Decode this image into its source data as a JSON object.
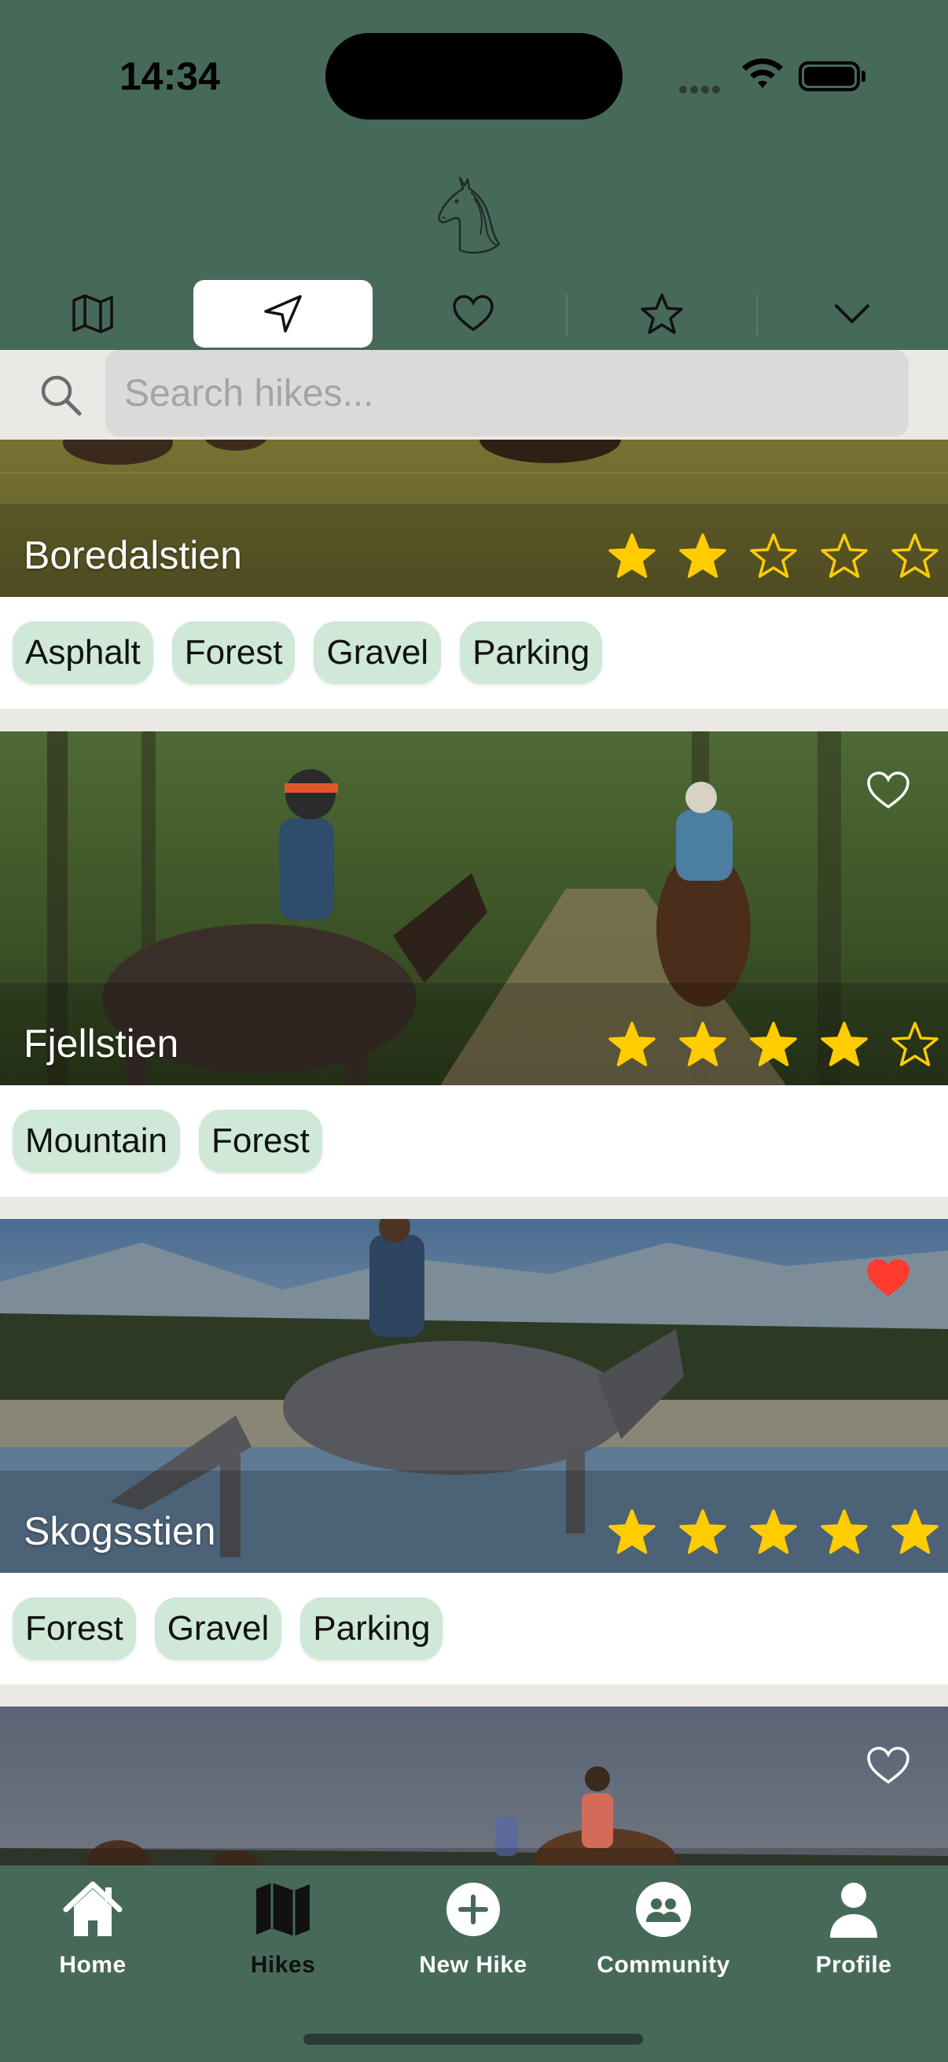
{
  "status_bar": {
    "time": "14:34"
  },
  "header": {
    "logo_icon": "horse-head-icon",
    "tabs": [
      {
        "icon": "map-icon",
        "active": false
      },
      {
        "icon": "navigation-arrow-icon",
        "active": true
      },
      {
        "icon": "heart-icon",
        "active": false
      },
      {
        "icon": "star-icon",
        "active": false
      },
      {
        "icon": "chevron-down-icon",
        "active": false
      }
    ]
  },
  "search": {
    "placeholder": "Search hikes...",
    "value": ""
  },
  "hikes": [
    {
      "name": "Boredalstien",
      "rating": 2,
      "favorite": false,
      "tags": [
        "Asphalt",
        "Forest",
        "Gravel",
        "Parking"
      ]
    },
    {
      "name": "Fjellstien",
      "rating": 4,
      "favorite": false,
      "tags": [
        "Mountain",
        "Forest"
      ]
    },
    {
      "name": "Skogsstien",
      "rating": 5,
      "favorite": true,
      "tags": [
        "Forest",
        "Gravel",
        "Parking"
      ]
    },
    {
      "name": "",
      "rating": 0,
      "favorite": false,
      "tags": []
    }
  ],
  "bottom_nav": [
    {
      "label": "Home",
      "icon": "home-icon",
      "active": false
    },
    {
      "label": "Hikes",
      "icon": "map-icon",
      "active": true
    },
    {
      "label": "New Hike",
      "icon": "plus-circle-icon",
      "active": false
    },
    {
      "label": "Community",
      "icon": "community-icon",
      "active": false
    },
    {
      "label": "Profile",
      "icon": "profile-icon",
      "active": false
    }
  ],
  "colors": {
    "primary": "#47695a",
    "tag_bg": "#cfe8d7",
    "star": "#ffcc00",
    "favorite": "#ff3b30"
  }
}
